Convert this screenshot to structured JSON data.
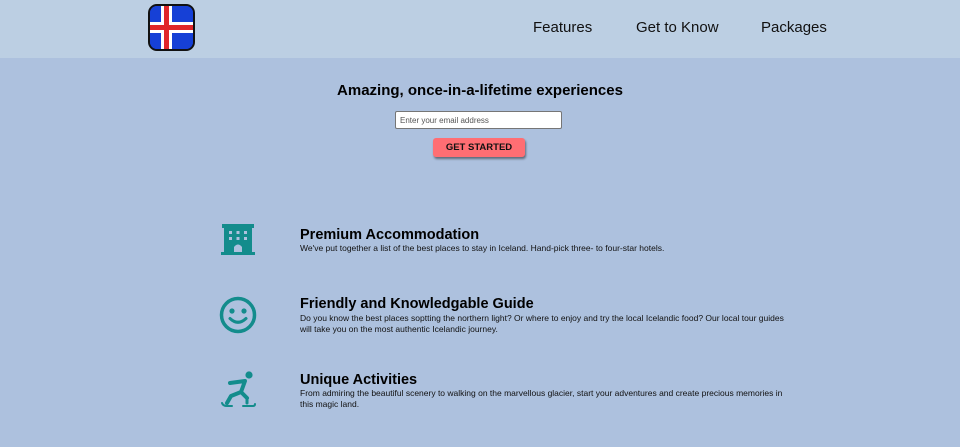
{
  "header": {
    "logo_icon": "iceland-flag-icon",
    "nav": [
      {
        "label": "Features"
      },
      {
        "label": "Get to Know"
      },
      {
        "label": "Packages"
      }
    ]
  },
  "hero": {
    "title": "Amazing, once-in-a-lifetime experiences",
    "email_placeholder": "Enter your email address",
    "cta_label": "GET STARTED"
  },
  "features": [
    {
      "icon": "hotel-icon",
      "title": "Premium Accommodation",
      "description": "We've put together a list of the best places to stay in Iceland. Hand-pick three- to four-star hotels."
    },
    {
      "icon": "smiley-icon",
      "title": "Friendly and Knowledgable Guide",
      "description": "Do you know the best places soptting the northern light? Or where to enjoy and try the local Icelandic food? Our local tour guides will take you on the most authentic Icelandic journey."
    },
    {
      "icon": "ice-skating-icon",
      "title": "Unique Activities",
      "description": "From admiring the beautiful scenery to walking on the marvellous glacier, start your adventures and create precious memories in this magic land."
    }
  ],
  "colors": {
    "page_bg": "#adc1de",
    "header_bg": "#bccfe3",
    "cta_bg": "#ff6e73",
    "icon_teal": "#138c8c",
    "flag_blue": "#1640d6",
    "flag_red": "#e0262a"
  }
}
